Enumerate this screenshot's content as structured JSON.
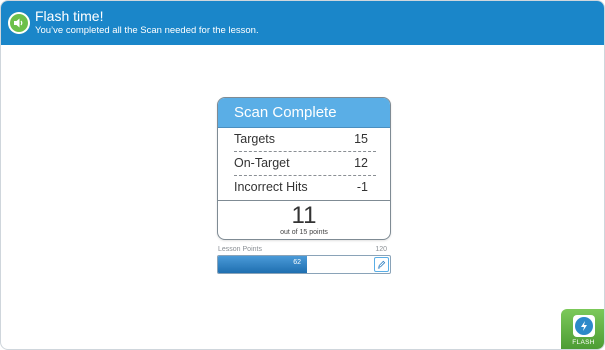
{
  "header": {
    "title": "Flash time!",
    "subtitle": "You’ve completed all the Scan needed for the lesson."
  },
  "card": {
    "title": "Scan Complete",
    "rows": [
      {
        "label": "Targets",
        "value": "15"
      },
      {
        "label": "On-Target",
        "value": "12"
      },
      {
        "label": "Incorrect Hits",
        "value": "-1"
      }
    ],
    "score": "11",
    "score_caption": "out of 15 points"
  },
  "lesson_points": {
    "label": "Lesson Points",
    "max": "120",
    "value": "62",
    "fraction": 0.517
  },
  "flash_button": {
    "label": "FLASH",
    "icon": "lightning-icon"
  },
  "colors": {
    "header": "#1a86c9",
    "card_header": "#5aaee6",
    "progress": "#2f7fc0",
    "flash": "#5aab3c",
    "speaker": "#6cc04a"
  }
}
